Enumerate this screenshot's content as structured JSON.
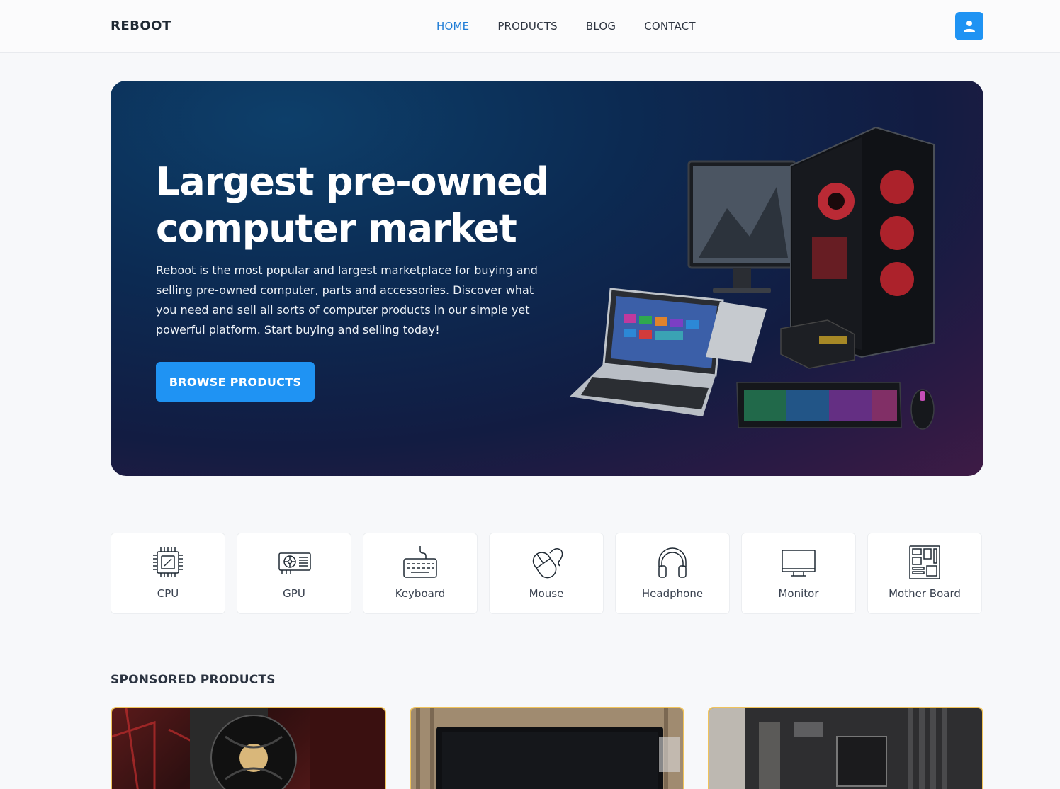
{
  "header": {
    "brand": "REBOOT",
    "nav": [
      "HOME",
      "PRODUCTS",
      "BLOG",
      "CONTACT"
    ],
    "active_nav": "HOME",
    "user_icon": "user-icon"
  },
  "hero": {
    "title_line1": "Largest pre-owned",
    "title_line2": "computer market",
    "description": "Reboot is the most popular and largest marketplace for buying and selling pre-owned computer, parts and accessories. Discover what you need and sell all sorts of computer products in our simple yet powerful platform. Start buying and selling today!",
    "cta": "BROWSE PRODUCTS"
  },
  "categories": [
    {
      "label": "CPU",
      "icon": "cpu-icon"
    },
    {
      "label": "GPU",
      "icon": "gpu-icon"
    },
    {
      "label": "Keyboard",
      "icon": "keyboard-icon"
    },
    {
      "label": "Mouse",
      "icon": "mouse-icon"
    },
    {
      "label": "Headphone",
      "icon": "headphone-icon"
    },
    {
      "label": "Monitor",
      "icon": "monitor-icon"
    },
    {
      "label": "Mother Board",
      "icon": "motherboard-icon"
    }
  ],
  "sponsored": {
    "title": "SPONSORED PRODUCTS"
  },
  "colors": {
    "accent": "#1f93f3",
    "active_link": "#1e7cd6",
    "sponsored_border": "#f0c35a"
  }
}
